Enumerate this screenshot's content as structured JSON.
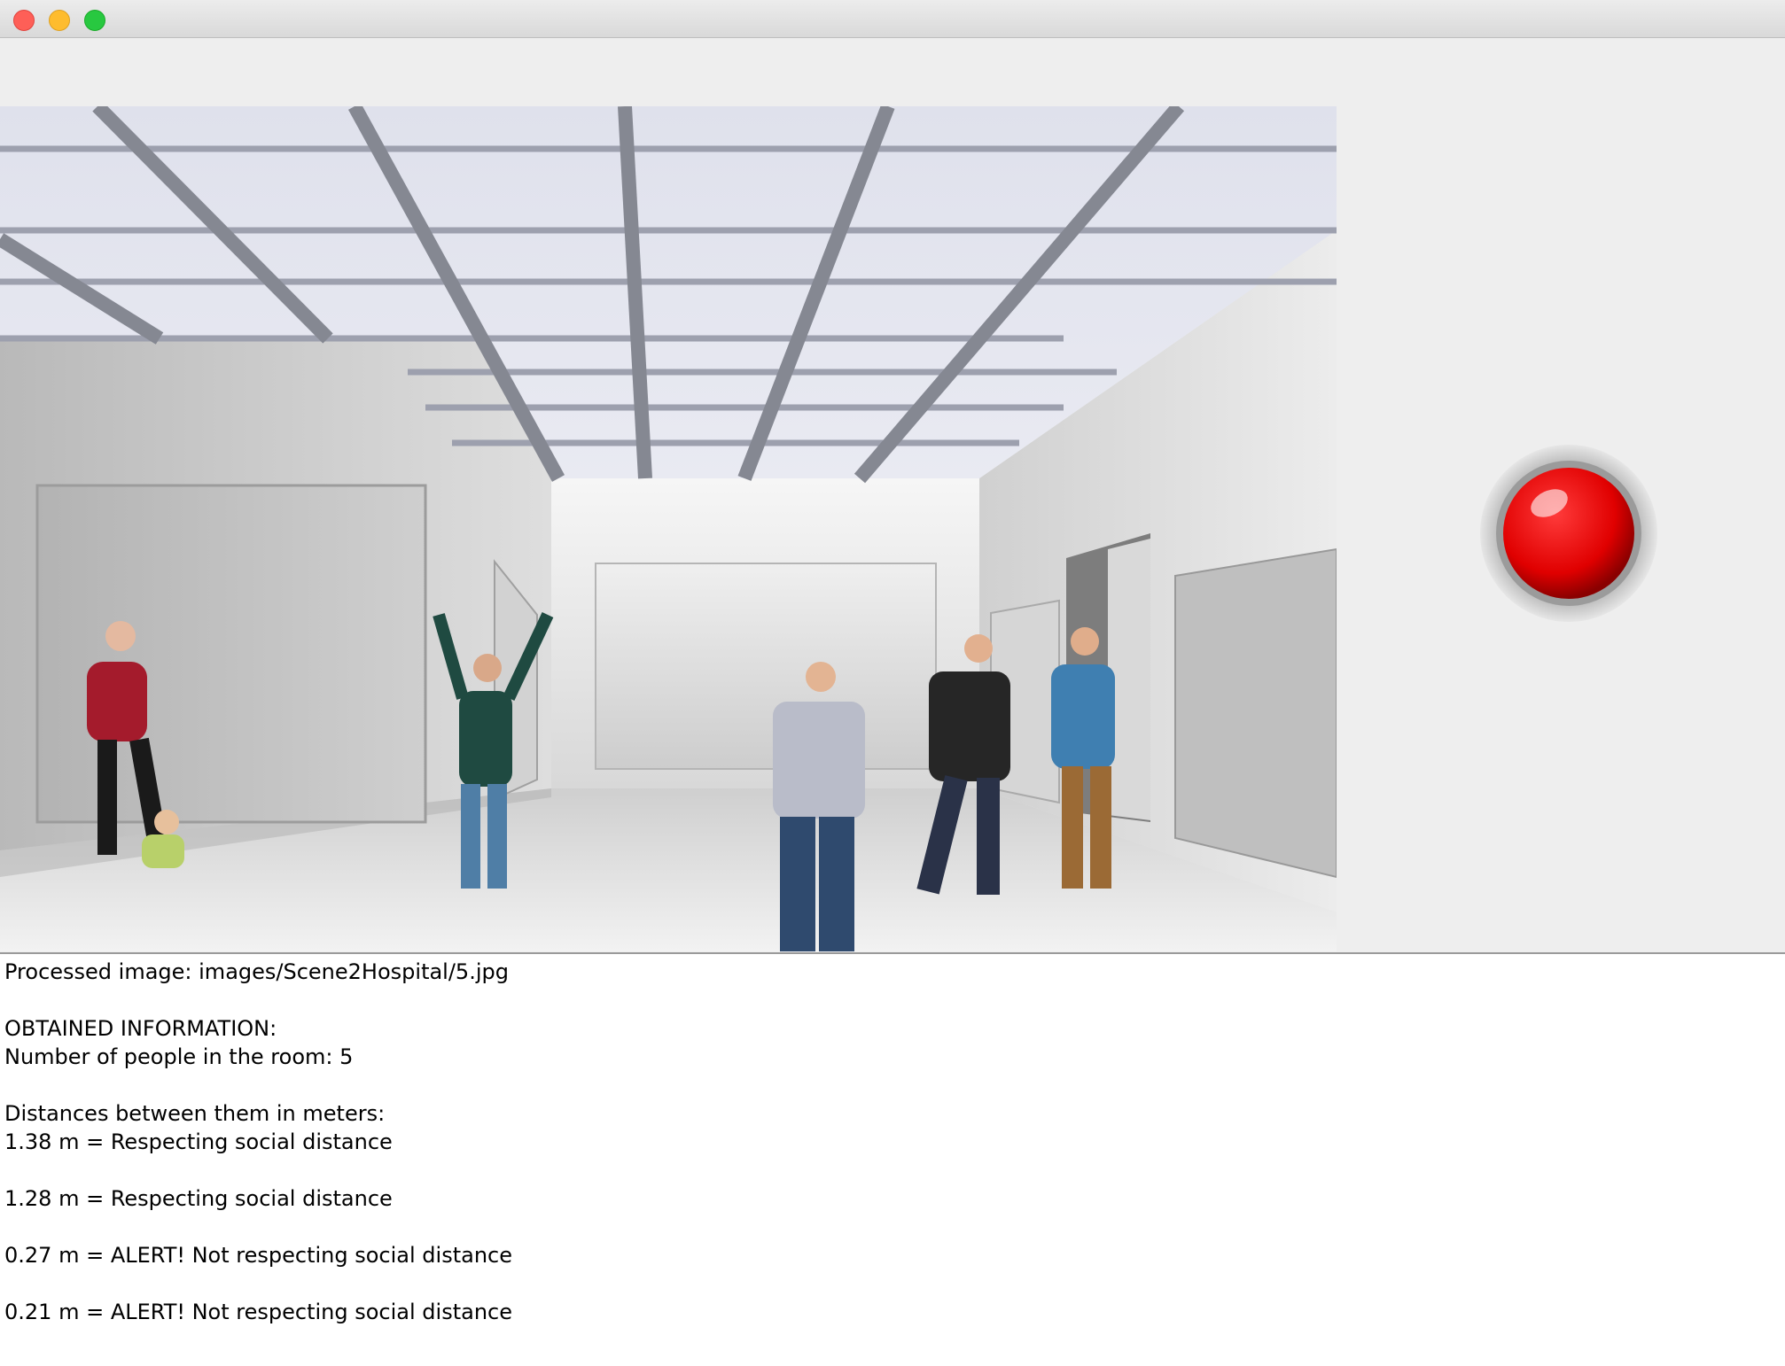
{
  "window": {
    "controls": [
      "close-button",
      "minimize-button",
      "maximize-button"
    ]
  },
  "scene": {
    "people_count": 5
  },
  "indicator": {
    "color": "#ff0000",
    "state": "alert"
  },
  "log": {
    "processed_line": "Processed image: images/Scene2Hospital/5.jpg",
    "header": "OBTAINED INFORMATION:",
    "people_line": "Number of people in the room: 5",
    "distances_header": "Distances between them in meters:",
    "distances": [
      "1.38 m = Respecting social distance",
      "1.28 m = Respecting social distance",
      "0.27 m = ALERT! Not respecting social distance",
      "0.21 m = ALERT! Not respecting social distance"
    ]
  },
  "colors": {
    "alert_red": "#ff0000",
    "window_bg": "#eeeeee",
    "log_bg": "#ffffff"
  }
}
